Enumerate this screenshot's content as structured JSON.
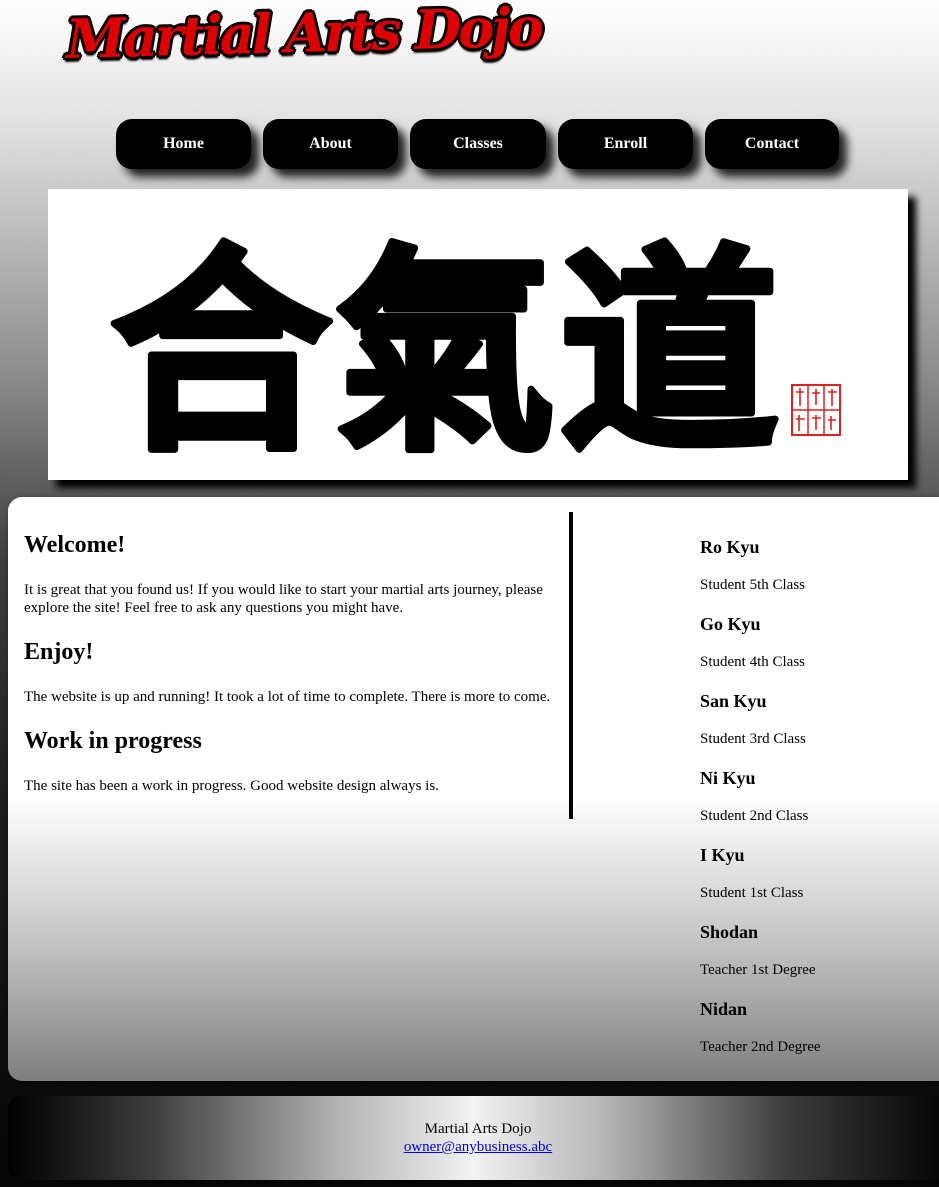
{
  "header": {
    "logo_text": "Martial Arts Dojo"
  },
  "nav": {
    "items": [
      "Home",
      "About",
      "Classes",
      "Enroll",
      "Contact"
    ]
  },
  "banner": {
    "calligraphy": "合氣道"
  },
  "main": {
    "sections": [
      {
        "heading": "Welcome!",
        "body": "It is great that you found us! If you would like to start your martial arts journey, please explore the site! Feel free to ask any questions you might have."
      },
      {
        "heading": "Enjoy!",
        "body": "The website is up and running! It took a lot of time to complete. There is more to come."
      },
      {
        "heading": "Work in progress",
        "body": "The site has been a work in progress. Good website design always is."
      }
    ]
  },
  "ranks": [
    {
      "name": "Ro Kyu",
      "description": "Student 5th Class"
    },
    {
      "name": "Go Kyu",
      "description": "Student 4th Class"
    },
    {
      "name": "San Kyu",
      "description": "Student 3rd Class"
    },
    {
      "name": "Ni Kyu",
      "description": "Student 2nd Class"
    },
    {
      "name": "I Kyu",
      "description": "Student 1st Class"
    },
    {
      "name": "Shodan",
      "description": "Teacher 1st Degree"
    },
    {
      "name": "Nidan",
      "description": "Teacher 2nd Degree"
    }
  ],
  "footer": {
    "name": "Martial Arts Dojo",
    "email": "owner@anybusiness.abc"
  },
  "colors": {
    "logo": "#e10000",
    "link": "#0000ee",
    "seal": "#e02020"
  }
}
